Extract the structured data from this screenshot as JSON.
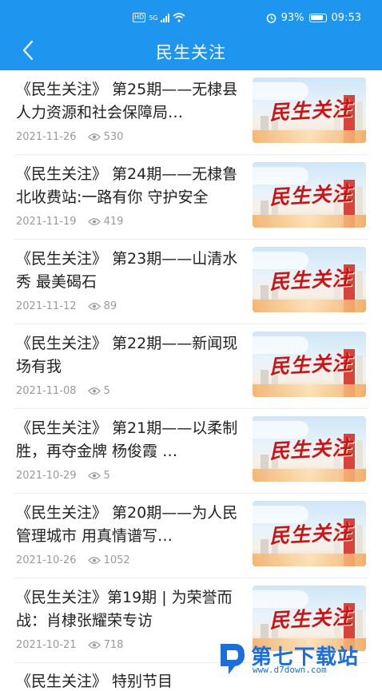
{
  "statusbar": {
    "hd": "HD",
    "network": "5G",
    "battery_pct": "93%",
    "time": "09:53"
  },
  "header": {
    "title": "民生关注"
  },
  "thumbnail_text": "民生关注",
  "items": [
    {
      "title": "《民生关注》 第25期——无棣县人力资源和社会保障局…",
      "date": "2021-11-26",
      "views": "530"
    },
    {
      "title": "《民生关注》 第24期——无棣鲁北收费站:一路有你 守护安全",
      "date": "2021-11-19",
      "views": "419"
    },
    {
      "title": "《民生关注》 第23期——山清水秀 最美碣石",
      "date": "2021-11-12",
      "views": "89"
    },
    {
      "title": "《民生关注》 第22期——新闻现场有我",
      "date": "2021-11-08",
      "views": "5"
    },
    {
      "title": "《民生关注》 第21期——以柔制胜，再夺金牌 杨俊霞 …",
      "date": "2021-10-29",
      "views": "5"
    },
    {
      "title": "《民生关注》 第20期——为人民管理城市  用真情谱写…",
      "date": "2021-10-26",
      "views": "1052"
    },
    {
      "title": "《民生关注》第19期 | 为荣誉而战：肖棣张耀荣专访",
      "date": "2021-10-21",
      "views": "718"
    }
  ],
  "partial_item": {
    "title": "《民生关注》 特别节目"
  },
  "watermark": {
    "brand": "第七下载站",
    "url": "www.d7down.com"
  },
  "colors": {
    "appbar": "#1e96f0",
    "text": "#222222",
    "meta": "#9a9a9a",
    "logo_red": "#c8151b",
    "watermark_blue": "#1c6fd9"
  }
}
